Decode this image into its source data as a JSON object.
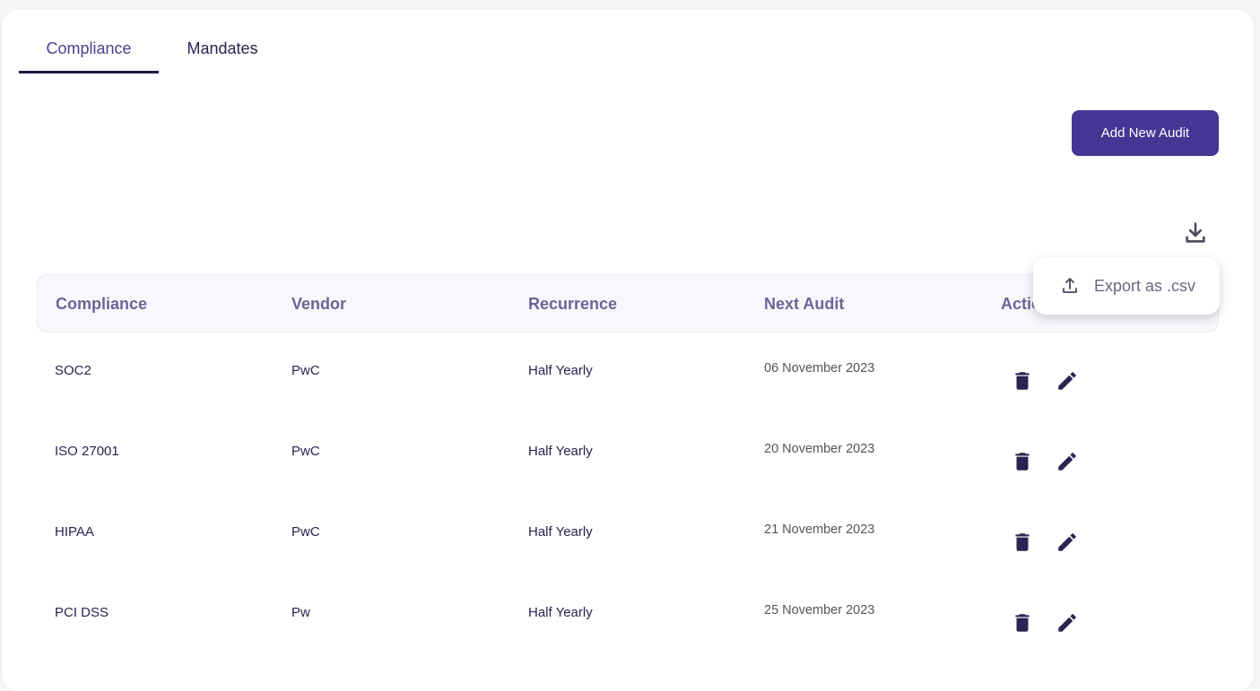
{
  "tabs": [
    {
      "label": "Compliance",
      "active": true
    },
    {
      "label": "Mandates",
      "active": false
    }
  ],
  "toolbar": {
    "add_label": "Add New Audit",
    "download_icon": "download-icon"
  },
  "export_menu": {
    "icon": "upload-icon",
    "label": "Export as .csv"
  },
  "table": {
    "headers": [
      "Compliance",
      "Vendor",
      "Recurrence",
      "Next Audit",
      "Actions"
    ],
    "rows": [
      {
        "compliance": "SOC2",
        "vendor": "PwC",
        "recurrence": "Half Yearly",
        "next_audit": "06 November 2023"
      },
      {
        "compliance": "ISO 27001",
        "vendor": "PwC",
        "recurrence": "Half Yearly",
        "next_audit": "20 November 2023"
      },
      {
        "compliance": "HIPAA",
        "vendor": "PwC",
        "recurrence": "Half Yearly",
        "next_audit": "21 November 2023"
      },
      {
        "compliance": "PCI DSS",
        "vendor": "Pw",
        "recurrence": "Half Yearly",
        "next_audit": "25 November 2023"
      }
    ]
  },
  "colors": {
    "accent": "#443693",
    "tab_indicator": "#1e1a45",
    "header_text": "#6d6396",
    "icon": "#2a2450"
  }
}
